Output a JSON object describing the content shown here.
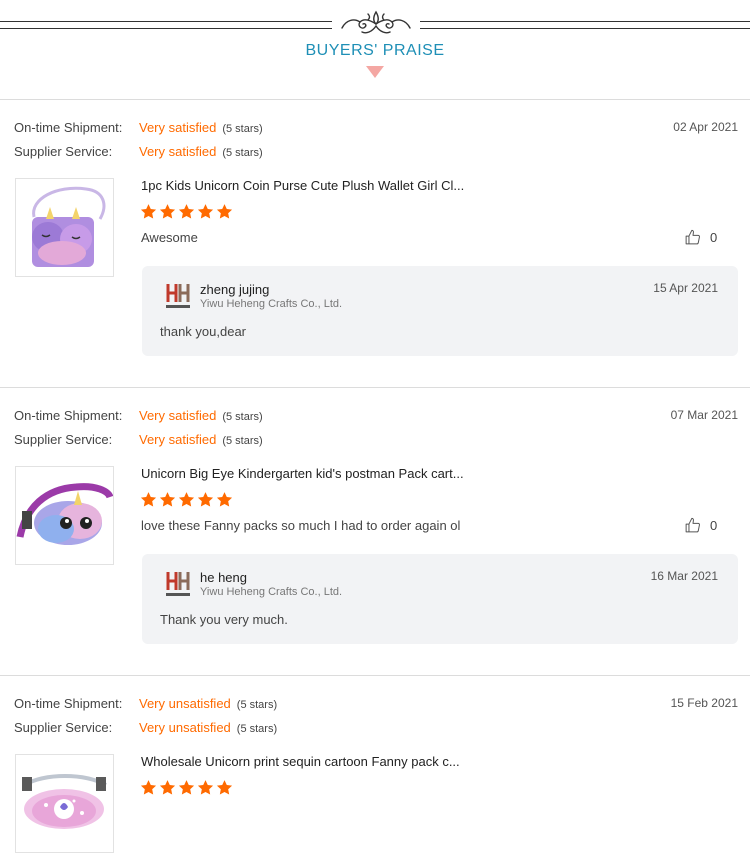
{
  "header": {
    "title": "BUYERS' PRAISE"
  },
  "colors": {
    "accent": "#ff6a00",
    "title_blue": "#1e8fb6",
    "arrow_pink": "#f4a7a3",
    "reply_bg": "#f2f3f5"
  },
  "icons": {
    "ornament": "scroll-ornament-icon",
    "like": "thumbs-up-icon",
    "star": "star-icon",
    "logo": "hh-logo-icon"
  },
  "reviews": [
    {
      "shipment_label": "On-time Shipment:",
      "shipment_value": "Very satisfied",
      "shipment_stars": "(5 stars)",
      "service_label": "Supplier Service:",
      "service_value": "Very satisfied",
      "service_stars": "(5 stars)",
      "date": "02 Apr 2021",
      "product_title": "1pc Kids Unicorn Coin Purse Cute Plush Wallet Girl Cl...",
      "product_rating": 5,
      "comment": "Awesome",
      "like_count": "0",
      "reply": {
        "name": "zheng jujing",
        "company": "Yiwu Heheng Crafts Co., Ltd.",
        "date": "15 Apr 2021",
        "text": "thank you,dear"
      }
    },
    {
      "shipment_label": "On-time Shipment:",
      "shipment_value": "Very satisfied",
      "shipment_stars": "(5 stars)",
      "service_label": "Supplier Service:",
      "service_value": "Very satisfied",
      "service_stars": "(5 stars)",
      "date": "07 Mar 2021",
      "product_title": "Unicorn Big Eye Kindergarten kid's postman Pack cart...",
      "product_rating": 5,
      "comment": "love these Fanny packs so much I had to order again  ol",
      "like_count": "0",
      "reply": {
        "name": "he heng",
        "company": "Yiwu Heheng Crafts Co., Ltd.",
        "date": "16 Mar 2021",
        "text": "Thank you very much."
      }
    },
    {
      "shipment_label": "On-time Shipment:",
      "shipment_value": "Very unsatisfied",
      "shipment_stars": "(5 stars)",
      "service_label": "Supplier Service:",
      "service_value": "Very unsatisfied",
      "service_stars": "(5 stars)",
      "date": "15 Feb 2021",
      "product_title": "Wholesale Unicorn print sequin cartoon Fanny pack c...",
      "product_rating": 5
    }
  ]
}
